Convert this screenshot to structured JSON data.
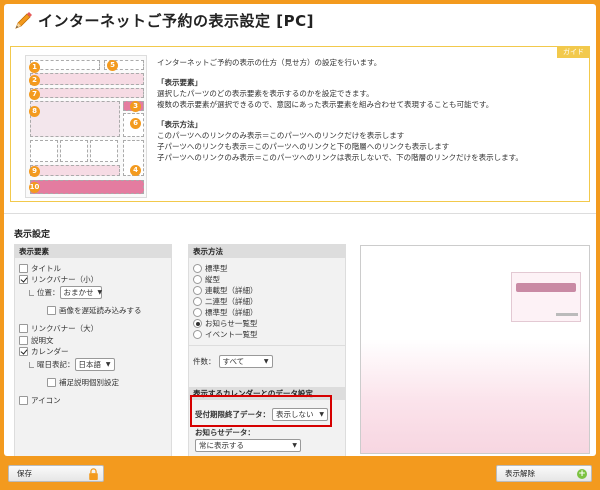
{
  "header": {
    "title": "インターネットご予約の表示設定 [PC]"
  },
  "guide": {
    "tag": "ガイド",
    "intro": "インターネットご予約の表示の仕方（見せ方）の設定を行います。",
    "section1_title": "「表示要素」",
    "section1_line1": "選択したパーツのどの表示要素を表示するのかを設定できます。",
    "section1_line2": "複数の表示要素が選択できるので、意図にあった表示要素を組み合わせて表現することも可能です。",
    "section2_title": "「表示方法」",
    "section2_line1": "このパーツへのリンクのみ表示＝このパーツへのリンクだけを表示します",
    "section2_line2": "子パーツへのリンクも表示＝このパーツへのリンクと下の階層へのリンクも表示します",
    "section2_line3": "子パーツへのリンクのみ表示＝このパーツへのリンクは表示しないで、下の階層のリンクだけを表示します。",
    "thumb_numbers": [
      "1",
      "2",
      "3",
      "4",
      "5",
      "6",
      "7",
      "8",
      "9",
      "10"
    ]
  },
  "settings": {
    "title": "表示設定",
    "elements_panel": {
      "header": "表示要素",
      "title_label": "タイトル",
      "link_banner_small": "リンクバナー（小）",
      "position_label": "位置：",
      "position_value": "おまかせ",
      "lazy_load_label": "画像を遅延読み込みする",
      "link_banner_large": "リンクバナー（大）",
      "description": "説明文",
      "calendar": "カレンダー",
      "weekday_label": "曜日表記：",
      "weekday_value": "日本語",
      "supplementary": "補足説明個別設定",
      "icon": "アイコン"
    },
    "method_panel": {
      "header": "表示方法",
      "options": [
        "標準型",
        "縦型",
        "連載型（詳細）",
        "二連型（詳細）",
        "標準型（詳細）",
        "お知らせ一覧型",
        "イベント一覧型"
      ],
      "selected_index": 5,
      "count_label": "件数：",
      "count_value": "すべて",
      "calendar_data_header": "表示するカレンダーとのデータ設定",
      "end_date_label": "受付期限終了データ：",
      "end_date_value": "表示しない",
      "notice_data_label": "お知らせデータ：",
      "notice_data_value": "常に表示する"
    }
  },
  "footer": {
    "save_label": "保存",
    "unpublish_label": "表示解除"
  },
  "colors": {
    "accent": "#f39a1e",
    "highlight": "#d60000",
    "guide_border": "#f2c94c"
  }
}
